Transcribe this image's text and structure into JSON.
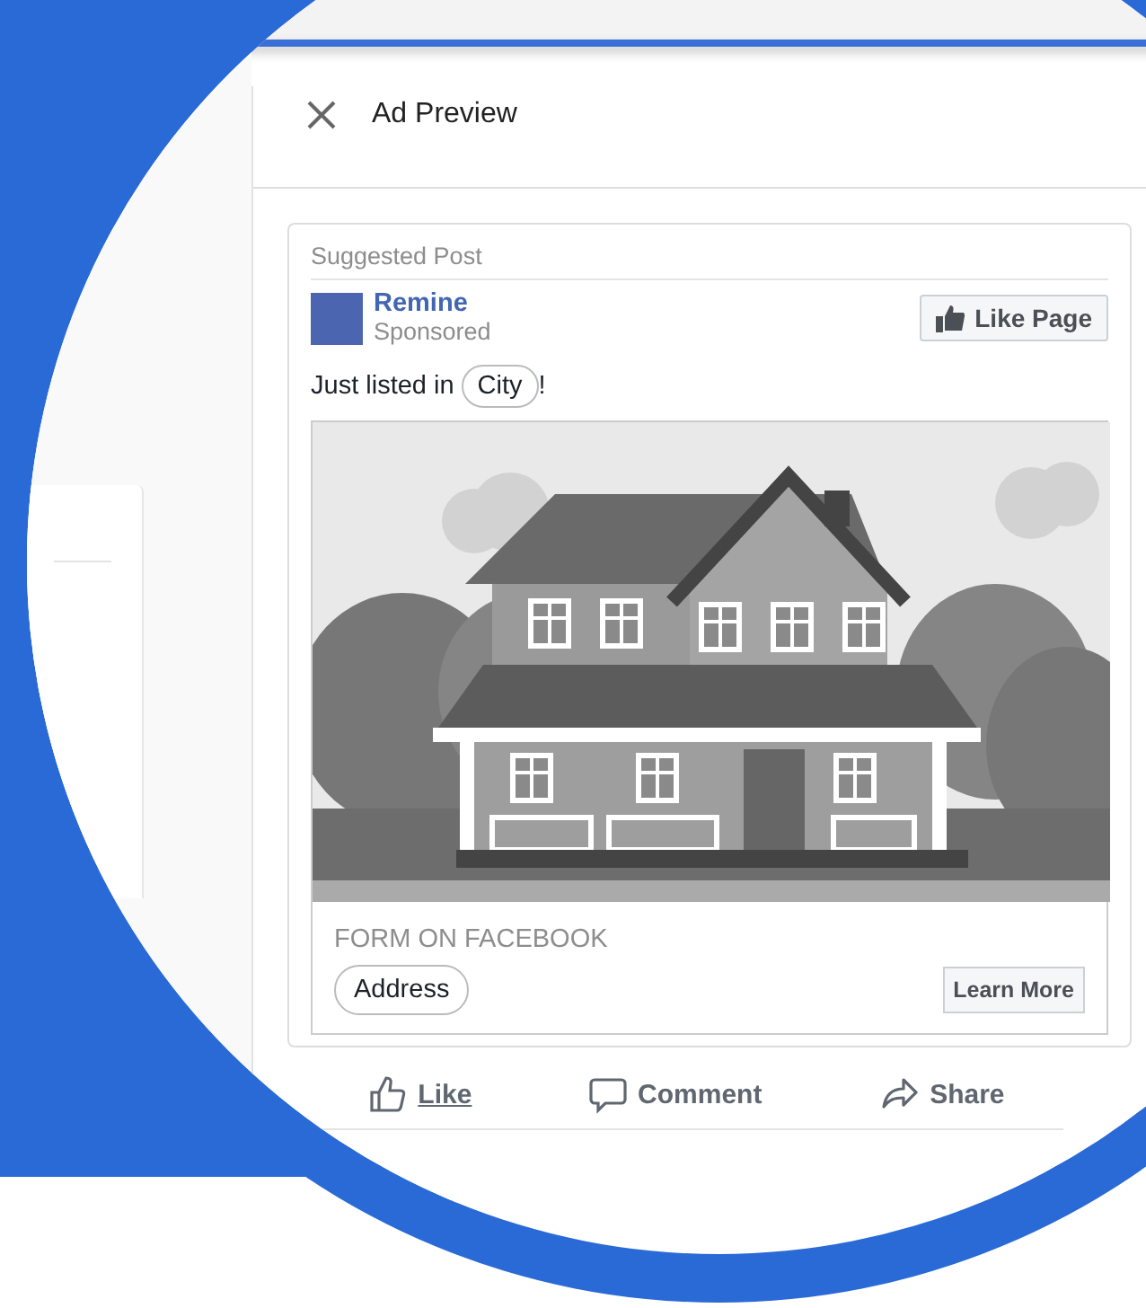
{
  "dialog": {
    "title": "Ad Preview"
  },
  "post": {
    "label": "Suggested Post",
    "page_name": "Remine",
    "sponsored": "Sponsored",
    "like_page": "Like Page",
    "text_before": "Just listed in",
    "token": "City",
    "text_after": "!",
    "form_label": "FORM ON FACEBOOK",
    "form_token": "Address",
    "cta": "Learn More"
  },
  "actions": [
    {
      "kind": "like",
      "label": "Like",
      "underlined": true
    },
    {
      "kind": "comment",
      "label": "Comment",
      "underlined": false
    },
    {
      "kind": "share",
      "label": "Share",
      "underlined": false
    }
  ]
}
